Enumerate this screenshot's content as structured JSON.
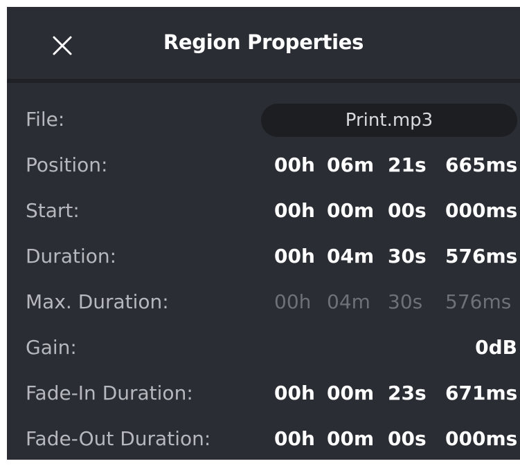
{
  "header": {
    "title": "Region Properties",
    "close_icon": "close-icon"
  },
  "rows": {
    "file": {
      "label": "File:",
      "value": "Print.mp3"
    },
    "position": {
      "label": "Position:",
      "h": "00h",
      "m": "06m",
      "s": "21s",
      "ms": "665ms"
    },
    "start": {
      "label": "Start:",
      "h": "00h",
      "m": "00m",
      "s": "00s",
      "ms": "000ms"
    },
    "duration": {
      "label": "Duration:",
      "h": "00h",
      "m": "04m",
      "s": "30s",
      "ms": "576ms"
    },
    "max_duration": {
      "label": "Max. Duration:",
      "h": "00h",
      "m": "04m",
      "s": "30s",
      "ms": "576ms"
    },
    "gain": {
      "label": "Gain:",
      "value": "0dB"
    },
    "fade_in": {
      "label": "Fade-In Duration:",
      "h": "00h",
      "m": "00m",
      "s": "23s",
      "ms": "671ms"
    },
    "fade_out": {
      "label": "Fade-Out Duration:",
      "h": "00h",
      "m": "00m",
      "s": "00s",
      "ms": "000ms"
    }
  },
  "colors": {
    "background": "#2a2d33",
    "label": "#b6b8bd",
    "value": "#ffffff",
    "disabled_value": "#6e7177",
    "pill": "#1c1e22"
  }
}
